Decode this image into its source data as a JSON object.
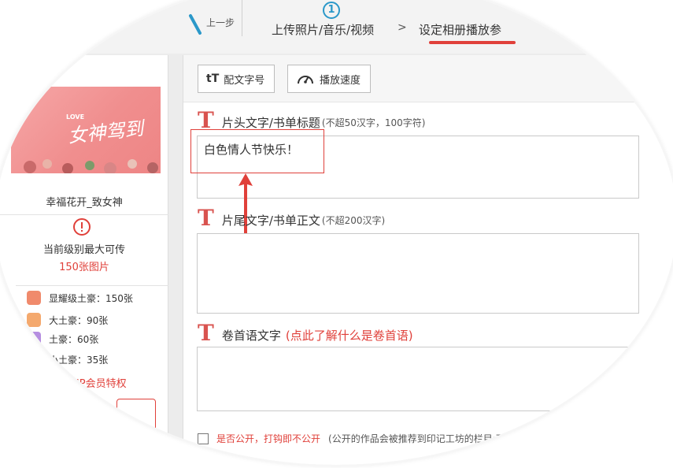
{
  "topbar": {
    "back_label": "上一步",
    "step1_number": "1",
    "step1_label": "上传照片/音乐/视频",
    "arrow": ">",
    "step2_label": "设定相册播放参"
  },
  "sidebar": {
    "album_name": "幸福花开_致女神",
    "banner_title": "女神驾到",
    "banner_love": "LOVE",
    "limit_label": "当前级别最大可传",
    "limit_value": "150张图片",
    "tiers": [
      {
        "label": "显耀级土豪：150张",
        "color": "#f08a6c"
      },
      {
        "label": "大土豪：90张",
        "color": "#f4a96e"
      },
      {
        "label": "土豪：60张",
        "color": "#b58ee0"
      },
      {
        "label": "小土豪：35张",
        "color": "#9bd0e6"
      }
    ],
    "vip_link": "VIP会员特权"
  },
  "toolbar": {
    "caption_font_label": "配文字号",
    "caption_font_icon": "tT",
    "speed_label": "播放速度"
  },
  "sections": {
    "title_label": "片头文字/书单标题",
    "title_hint": "(不超50汉字，100字符)",
    "title_value": "白色情人节快乐！",
    "ending_label": "片尾文字/书单正文",
    "ending_hint": "(不超200汉字)",
    "ending_value": "",
    "preface_label": "卷首语文字",
    "preface_link": "(点此了解什么是卷首语)",
    "preface_value": ""
  },
  "public": {
    "label": "是否公开，打钩即不公开",
    "note": "(公开的作品会被推荐到印记工坊的栏目:不"
  },
  "colors": {
    "accent_red": "#e0403a",
    "step_blue": "#2b98c9",
    "t_icon_red": "#d9534f"
  }
}
